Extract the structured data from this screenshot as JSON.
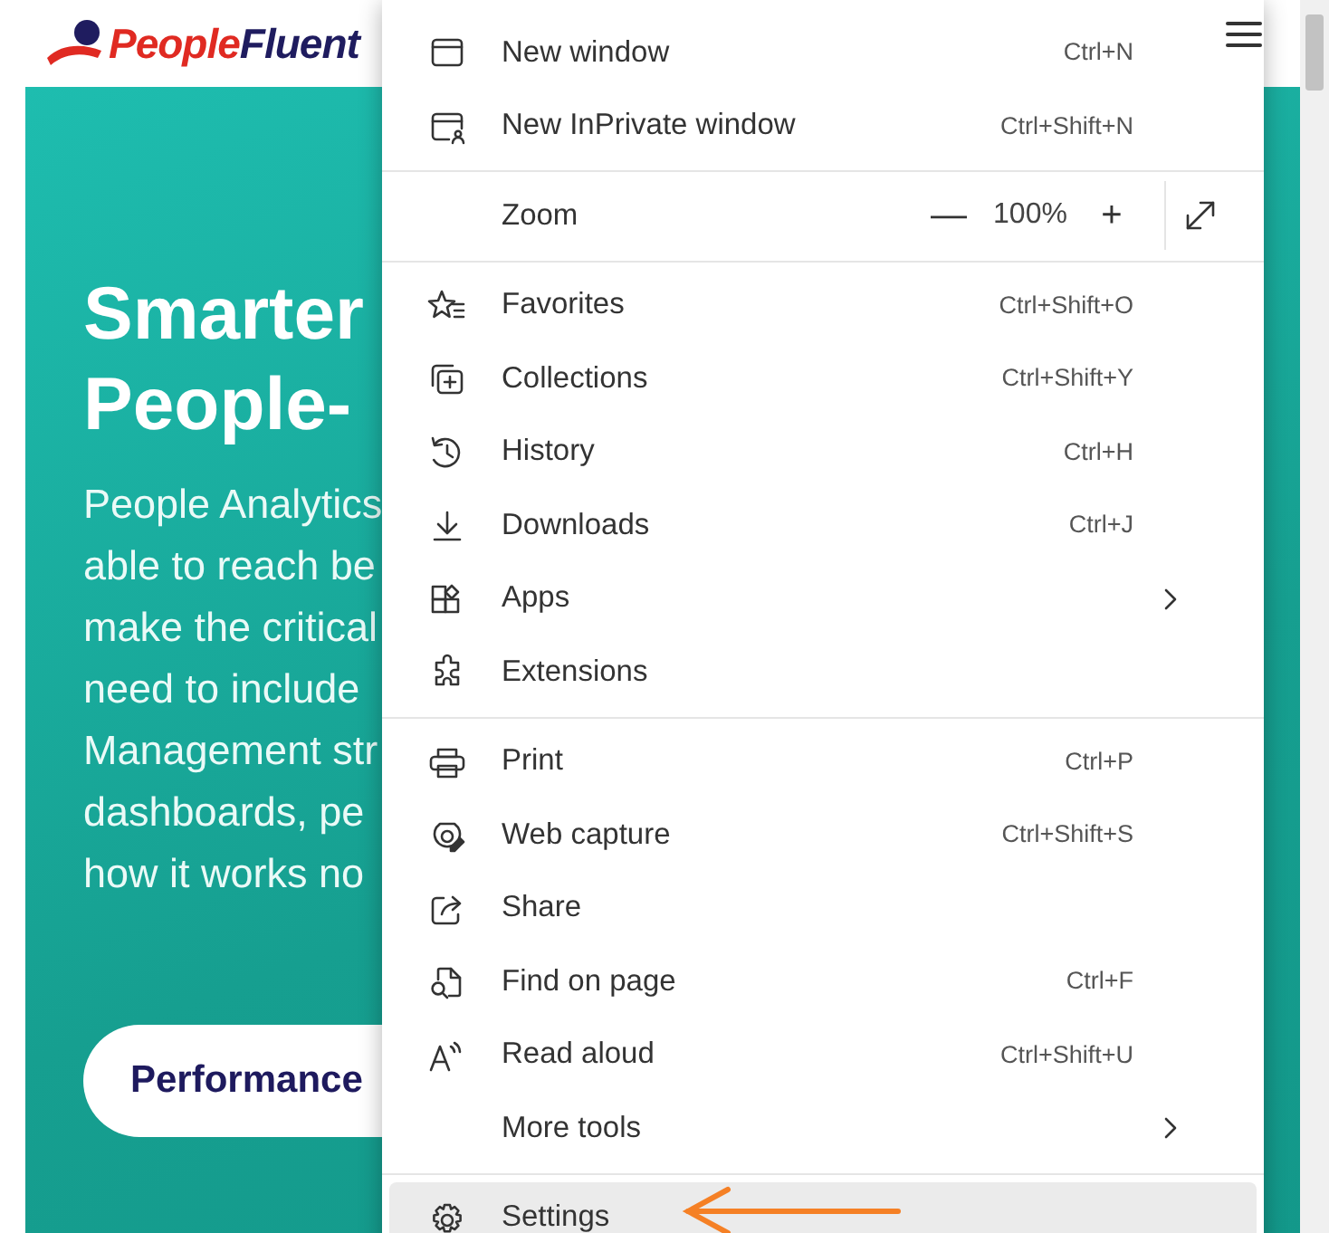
{
  "header": {
    "logo_parts": [
      "People",
      "Fluent"
    ]
  },
  "hero": {
    "heading_lines": [
      "Smarter",
      "People-"
    ],
    "body_lines": [
      "People Analytics",
      "able to reach be",
      "make the critical",
      "need to include",
      "Management str",
      "dashboards, pe",
      "how it works no"
    ],
    "button": "Performance"
  },
  "menu": {
    "groups": [
      [
        {
          "kind": "item",
          "label": "New window",
          "shortcut": "Ctrl+N",
          "submenu": false,
          "selected": false
        },
        {
          "kind": "item",
          "label": "New InPrivate window",
          "shortcut": "Ctrl+Shift+N",
          "submenu": false,
          "selected": false
        }
      ],
      [
        {
          "kind": "zoom",
          "label": "Zoom",
          "minus": "—",
          "value": "100%",
          "plus": "+",
          "selected": false
        }
      ],
      [
        {
          "kind": "item",
          "label": "Favorites",
          "shortcut": "Ctrl+Shift+O",
          "submenu": false,
          "selected": false
        },
        {
          "kind": "item",
          "label": "Collections",
          "shortcut": "Ctrl+Shift+Y",
          "submenu": false,
          "selected": false
        },
        {
          "kind": "item",
          "label": "History",
          "shortcut": "Ctrl+H",
          "submenu": false,
          "selected": false
        },
        {
          "kind": "item",
          "label": "Downloads",
          "shortcut": "Ctrl+J",
          "submenu": false,
          "selected": false
        },
        {
          "kind": "item",
          "label": "Apps",
          "submenu": true,
          "selected": false
        },
        {
          "kind": "item",
          "label": "Extensions",
          "submenu": false,
          "selected": false
        }
      ],
      [
        {
          "kind": "item",
          "label": "Print",
          "shortcut": "Ctrl+P",
          "submenu": false,
          "selected": false
        },
        {
          "kind": "item",
          "label": "Web capture",
          "shortcut": "Ctrl+Shift+S",
          "submenu": false,
          "selected": false
        },
        {
          "kind": "item",
          "label": "Share",
          "submenu": false,
          "selected": false
        },
        {
          "kind": "item",
          "label": "Find on page",
          "shortcut": "Ctrl+F",
          "submenu": false,
          "selected": false
        },
        {
          "kind": "item",
          "label": "Read aloud",
          "shortcut": "Ctrl+Shift+U",
          "submenu": false,
          "selected": false
        },
        {
          "kind": "item",
          "label": "More tools",
          "submenu": true,
          "selected": false
        }
      ],
      [
        {
          "kind": "item",
          "label": "Settings",
          "submenu": false,
          "selected": true
        }
      ]
    ]
  }
}
